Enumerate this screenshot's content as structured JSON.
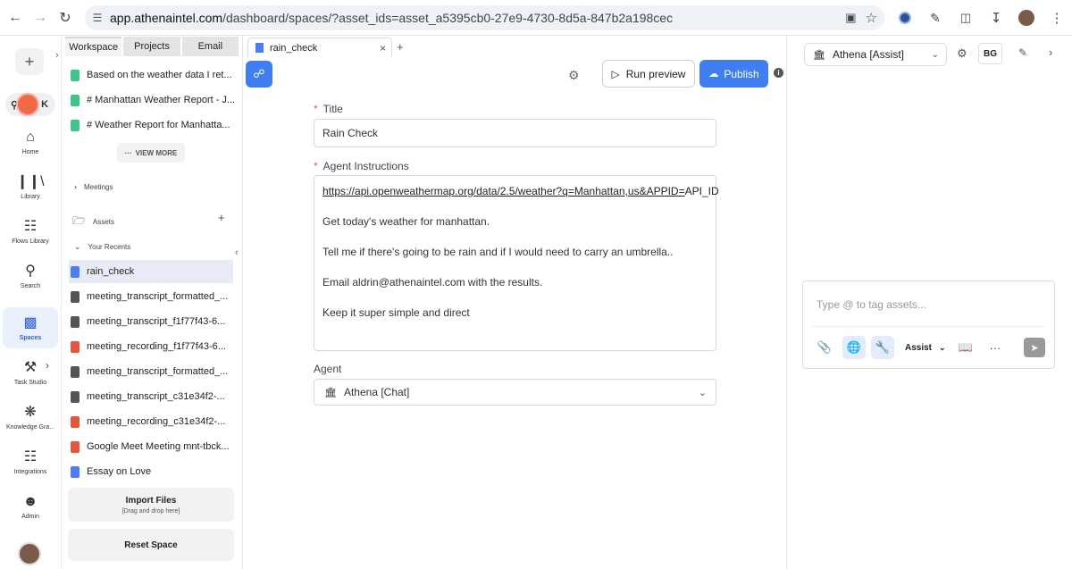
{
  "browser": {
    "url_host": "app.athenaintel.com",
    "url_path": "/dashboard/spaces/?asset_ids=asset_a5395cb0-27e9-4730-8d5a-847b2a198cec"
  },
  "rail": {
    "search_label": "K",
    "items": [
      {
        "label": "Home",
        "icon": "home-icon"
      },
      {
        "label": "Library",
        "icon": "library-icon"
      },
      {
        "label": "Flows Library",
        "icon": "flows-icon"
      },
      {
        "label": "Search",
        "icon": "search-icon"
      },
      {
        "label": "Spaces",
        "icon": "spaces-icon"
      },
      {
        "label": "Task Studio",
        "icon": "tools-icon"
      },
      {
        "label": "Knowledge Gra...",
        "icon": "graph-icon"
      },
      {
        "label": "Integrations",
        "icon": "integrations-icon"
      },
      {
        "label": "Admin",
        "icon": "admin-icon"
      }
    ]
  },
  "panel": {
    "tabs": [
      "Workspace",
      "Projects",
      "Email"
    ],
    "recent_chats": [
      "Based on the weather data I ret...",
      "# Manhattan Weather Report - J...",
      "# Weather Report for Manhatta..."
    ],
    "view_more": "VIEW MORE",
    "meetings_label": "Meetings",
    "assets_label": "Assets",
    "recents_label": "Your Recents",
    "recents": [
      {
        "name": "rain_check",
        "type": "blue"
      },
      {
        "name": "meeting_transcript_formatted_...",
        "type": "dark"
      },
      {
        "name": "meeting_transcript_f1f77f43-6...",
        "type": "dark"
      },
      {
        "name": "meeting_recording_f1f77f43-6...",
        "type": "red"
      },
      {
        "name": "meeting_transcript_formatted_...",
        "type": "dark"
      },
      {
        "name": "meeting_transcript_c31e34f2-...",
        "type": "dark"
      },
      {
        "name": "meeting_recording_c31e34f2-...",
        "type": "red"
      },
      {
        "name": "Google Meet Meeting mnt-tbck...",
        "type": "red"
      },
      {
        "name": "Essay on Love",
        "type": "blue"
      }
    ],
    "import_title": "Import Files",
    "import_sub": "[Drag and drop here]",
    "reset_label": "Reset Space"
  },
  "editor": {
    "tab_label": "rain_check",
    "run_preview": "Run preview",
    "publish": "Publish",
    "title_label": "Title",
    "title_value": "Rain Check",
    "instructions_label": "Agent Instructions",
    "instructions_link": "https://api.openweathermap.org/data/2.5/weather?q=Manhattan,us&APPID=",
    "instructions_link_tail": "API_ID",
    "instructions": [
      "Get today's weather for manhattan.",
      "Tell me if there's going to be rain and if I would need to carry an umbrella..",
      "Email aldrin@athenaintel.com with the results.",
      "Keep it super simple and direct"
    ],
    "agent_label": "Agent",
    "agent_value": "Athena [Chat]"
  },
  "assist": {
    "selected_agent": "Athena [Assist]",
    "badge": "BG",
    "placeholder": "Type @ to tag assets...",
    "mode": "Assist"
  },
  "colors": {
    "accent": "#3f7ef0",
    "required": "#e4563d"
  }
}
